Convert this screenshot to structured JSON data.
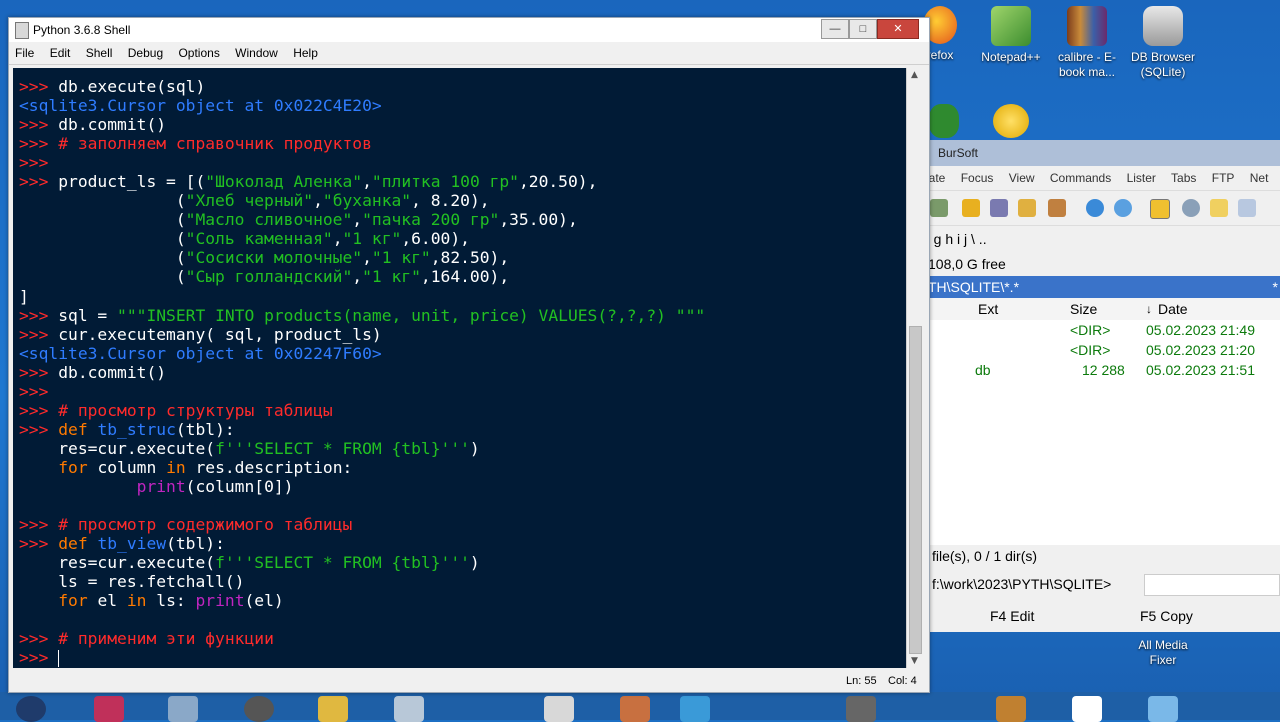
{
  "desktop": {
    "icons": [
      {
        "label": "refox"
      },
      {
        "label": "Notepad++"
      },
      {
        "label": "calibre - E-book ma..."
      },
      {
        "label": "DB Browser (SQLite)"
      },
      {
        "label": "All Media Fixer"
      }
    ]
  },
  "commander": {
    "title": "BurSoft",
    "menu": [
      "gate",
      "Focus",
      "View",
      "Commands",
      "Lister",
      "Tabs",
      "FTP",
      "Net"
    ],
    "drives": "g  h  i  j  \\  ..",
    "free": "108,0 G free",
    "path": "TH\\SQLITE\\*.*",
    "path_marker": "*",
    "columns": {
      "ext": "Ext",
      "size": "Size",
      "date": "Date"
    },
    "rows": [
      {
        "name": "",
        "size": "<DIR>",
        "date": "05.02.2023 21:49"
      },
      {
        "name": "",
        "size": "<DIR>",
        "date": "05.02.2023 21:20"
      },
      {
        "name": "db",
        "size": "12 288",
        "date": "05.02.2023 21:51"
      }
    ],
    "status": "file(s), 0 / 1 dir(s)",
    "cmdline": "f:\\work\\2023\\PYTH\\SQLITE>",
    "fkeys": {
      "f4": "F4 Edit",
      "f5": "F5 Copy"
    }
  },
  "shell": {
    "title": "Python 3.6.8 Shell",
    "menu": [
      "File",
      "Edit",
      "Shell",
      "Debug",
      "Options",
      "Window",
      "Help"
    ],
    "status": {
      "line": "Ln: 55",
      "col": "Col: 4"
    },
    "prompt": ">>> ",
    "code": {
      "l1": "db.execute(sql)",
      "l2": "<sqlite3.Cursor object at 0x022C4E20>",
      "l3": "db.commit()",
      "l4": "# заполняем справочник продуктов",
      "l6a": "product_ls = [(",
      "s1": "\"Шоколад Аленка\"",
      "s2": "\"плитка 100 гр\"",
      "n1": ",20.50),",
      "s3": "\"Хлеб черный\"",
      "s4": "\"буханка\"",
      "n2": ", 8.20),",
      "s5": "\"Масло сливочное\"",
      "s6": "\"пачка 200 гр\"",
      "n3": ",35.00),",
      "s7": "\"Соль каменная\"",
      "s8": "\"1 кг\"",
      "n4": ",6.00),",
      "s9": "\"Сосиски молочные\"",
      "s10": "\"1 кг\"",
      "n5": ",82.50),",
      "s11": "\"Сыр голландский\"",
      "s12": "\"1 кг\"",
      "n6": ",164.00),",
      "close": "]",
      "sqlvar": "sql = ",
      "sqlstr": "\"\"\"INSERT INTO products(name, unit, price) VALUES(?,?,?) \"\"\"",
      "l14": "cur.executemany( sql, product_ls)",
      "l15": "<sqlite3.Cursor object at 0x02247F60>",
      "l16": "db.commit()",
      "c1": "# просмотр структуры таблицы",
      "def": "def",
      "fn1": "tb_struc",
      "args": "(tbl):",
      "res": "res=cur.execute(",
      "fstr": "f'''SELECT * FROM {tbl}'''",
      "paren": ")",
      "for": "for",
      "colvar": " column ",
      "in": "in",
      "desc": " res.description:",
      "print": "print",
      "pargs": "(column[0])",
      "c2": "# просмотр содержимого таблицы",
      "fn2": "tb_view",
      "fetch": "ls = res.fetchall()",
      "elvar": " el ",
      "lsvar": " ls: ",
      "pel": "(el)",
      "c3": "# применим эти функции"
    }
  }
}
